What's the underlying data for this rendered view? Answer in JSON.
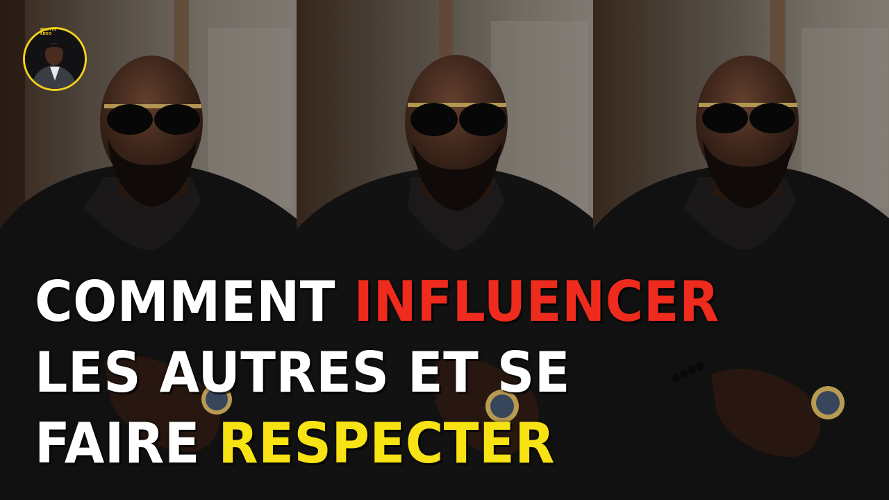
{
  "thumbnail": {
    "headline": {
      "line1": {
        "word1": "COMMENT",
        "word2": "INFLUENCER"
      },
      "line2": {
        "text": "LES AUTRES ET SE"
      },
      "line3": {
        "word1": "FAIRE",
        "word2": "RESPECTER"
      }
    },
    "avatar": {
      "badge_line1": "MARTIN",
      "badge_line2": "EDEO"
    },
    "colors": {
      "headline_white": "#ffffff",
      "highlight_red": "#ee2b1c",
      "highlight_yellow": "#f7e214",
      "avatar_ring": "#f2d21b"
    },
    "icons": [
      "channel-avatar",
      "sunglasses",
      "wristwatch",
      "bead-bracelet"
    ]
  }
}
